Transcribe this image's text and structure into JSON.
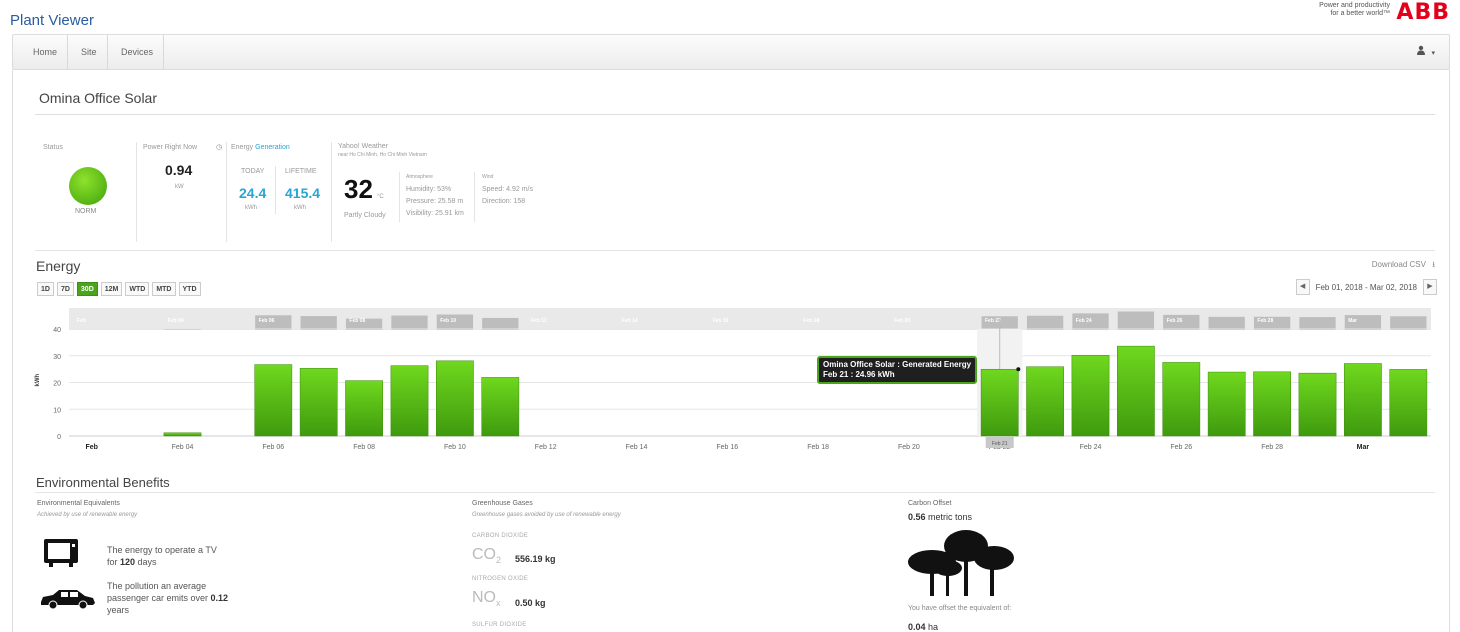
{
  "header": {
    "app_title": "Plant Viewer",
    "tagline_line1": "Power and productivity",
    "tagline_line2": "for a better world™",
    "logo": "ABB"
  },
  "nav": {
    "items": [
      "Home",
      "Site",
      "Devices"
    ],
    "user_icon": "user-icon"
  },
  "page": {
    "title": "Omina Office Solar"
  },
  "status": {
    "label": "Status",
    "value": "NORM",
    "color": "#5cc019"
  },
  "power": {
    "label": "Power Right Now",
    "value": "0.94",
    "unit": "kW"
  },
  "energy_gen": {
    "label": "Energy",
    "label_link": "Generation",
    "today_label": "TODAY",
    "lifetime_label": "LIFETIME",
    "today_value": "24.4",
    "lifetime_value": "415.4",
    "today_unit": "kWh",
    "lifetime_unit": "kWh"
  },
  "weather": {
    "title": "Yahoo! Weather",
    "location": "near Ho Chi Minh, Ho Chi Minh Vietnam",
    "temp": "32",
    "temp_unit": "°C",
    "condition": "Partly Cloudy",
    "atm_title": "Atmosphere",
    "humidity": "Humidity: 53%",
    "pressure": "Pressure: 25.58 m",
    "visibility": "Visibility: 25.91 km",
    "wind_title": "Wind",
    "speed": "Speed: 4.92 m/s",
    "direction": "Direction: 158"
  },
  "energy_chart_ui": {
    "title": "Energy",
    "ranges": [
      "1D",
      "7D",
      "30D",
      "12M",
      "WTD",
      "MTD",
      "YTD"
    ],
    "active_range": "30D",
    "download": "Download CSV",
    "date_range": "Feb 01, 2018 - Mar 02, 2018",
    "tooltip_line1": "Omina Office Solar : Generated Energy",
    "tooltip_line2": "Feb 21 : 24.96 kWh",
    "highlight_label": "Feb 21"
  },
  "chart_data": {
    "type": "bar",
    "ylabel": "kWh",
    "ylim": [
      0,
      40
    ],
    "yticks": [
      0,
      10,
      20,
      30,
      40
    ],
    "x_tick_labels": [
      "Feb",
      "Feb 04",
      "Feb 06",
      "Feb 08",
      "Feb 10",
      "Feb 12",
      "Feb 14",
      "Feb 16",
      "Feb 18",
      "Feb 20",
      "Feb 22",
      "Feb 24",
      "Feb 26",
      "Feb 28",
      "Mar"
    ],
    "navigator_labels": [
      "Feb",
      "Feb 04",
      "Feb 06",
      "Feb 08",
      "Feb 10",
      "Feb 12",
      "Feb 14",
      "Feb 16",
      "Feb 18",
      "Feb 20",
      "Feb 22",
      "Feb 24",
      "Feb 26",
      "Feb 28",
      "Mar"
    ],
    "categories": [
      "Feb 01",
      "Feb 02",
      "Feb 03",
      "Feb 04",
      "Feb 05",
      "Feb 06",
      "Feb 07",
      "Feb 08",
      "Feb 09",
      "Feb 10",
      "Feb 11",
      "Feb 12",
      "Feb 13",
      "Feb 14",
      "Feb 15",
      "Feb 16",
      "Feb 17",
      "Feb 18",
      "Feb 19",
      "Feb 20",
      "Feb 21",
      "Feb 22",
      "Feb 23",
      "Feb 24",
      "Feb 25",
      "Feb 26",
      "Feb 27",
      "Feb 28",
      "Mar 01",
      "Mar 02"
    ],
    "values": [
      0,
      0,
      1.2,
      0,
      26.7,
      25.3,
      20.7,
      26.3,
      28.1,
      21.9,
      0,
      0,
      0,
      0,
      0,
      0,
      0,
      0,
      0,
      0,
      24.96,
      25.9,
      30.2,
      33.6,
      27.5,
      23.9,
      24.0,
      23.5,
      27.1,
      24.9
    ],
    "bar_color": "#5cc019",
    "grid": true
  },
  "env": {
    "title": "Environmental Benefits",
    "equiv_title": "Environmental Equivalents",
    "equiv_sub": "Achieved by use of renewable energy",
    "tv_line1": "The energy to operate a TV",
    "tv_line2_pre": "for ",
    "tv_days": "120",
    "tv_line2_post": " days",
    "car_line1": "The pollution an average",
    "car_line2_pre": "passenger car emits over ",
    "car_years": "0.12",
    "car_line3": "years",
    "gas_title": "Greenhouse Gases",
    "gas_sub": "Greenhouse gases avoided by use of renewable energy",
    "co2_label": "CARBON DIOXIDE",
    "co2_formula": "CO",
    "co2_sub": "2",
    "co2_value": "556.19 kg",
    "nox_label": "NITROGEN OXIDE",
    "nox_formula": "NO",
    "nox_sub": "x",
    "nox_value": "0.50 kg",
    "so2_label": "SULFUR DIOXIDE",
    "carbon_title": "Carbon Offset",
    "carbon_value": "0.56",
    "carbon_unit": " metric tons",
    "offset_text": "You have offset the equivalent of:",
    "offset_value": "0.04",
    "offset_unit": " ha"
  }
}
